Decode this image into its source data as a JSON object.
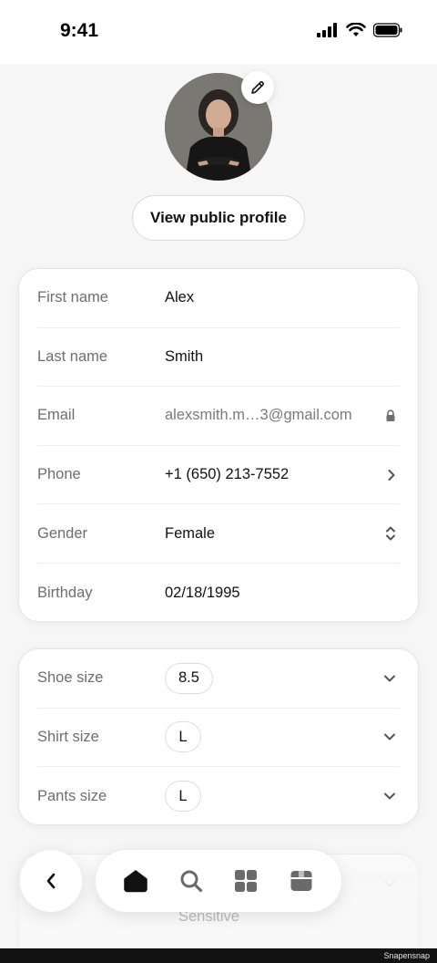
{
  "status_bar": {
    "time": "9:41"
  },
  "profile": {
    "view_public_profile": "View public profile"
  },
  "personal_info": {
    "rows": [
      {
        "label": "First name",
        "value": "Alex"
      },
      {
        "label": "Last name",
        "value": "Smith"
      },
      {
        "label": "Email",
        "value": "alexsmith.m…3@gmail.com",
        "icon": "lock-icon"
      },
      {
        "label": "Phone",
        "value": "+1 (650) 213-7552",
        "icon": "chevron-right-icon"
      },
      {
        "label": "Gender",
        "value": "Female",
        "icon": "up-down-chevron-icon"
      },
      {
        "label": "Birthday",
        "value": "02/18/1995"
      }
    ]
  },
  "sizes": {
    "rows": [
      {
        "label": "Shoe size",
        "value": "8.5",
        "icon": "chevron-down-icon"
      },
      {
        "label": "Shirt size",
        "value": "L",
        "icon": "chevron-down-icon"
      },
      {
        "label": "Pants size",
        "value": "L",
        "icon": "chevron-down-icon"
      }
    ]
  },
  "faded": {
    "sensitive_label": "Sensitive"
  },
  "nav": {
    "back_icon": "chevron-left-icon",
    "tabs": [
      {
        "name": "home-icon",
        "active": true
      },
      {
        "name": "search-icon",
        "active": false
      },
      {
        "name": "grid-icon",
        "active": false
      },
      {
        "name": "box-icon",
        "active": false
      }
    ]
  },
  "watermark": "Snapensnap"
}
